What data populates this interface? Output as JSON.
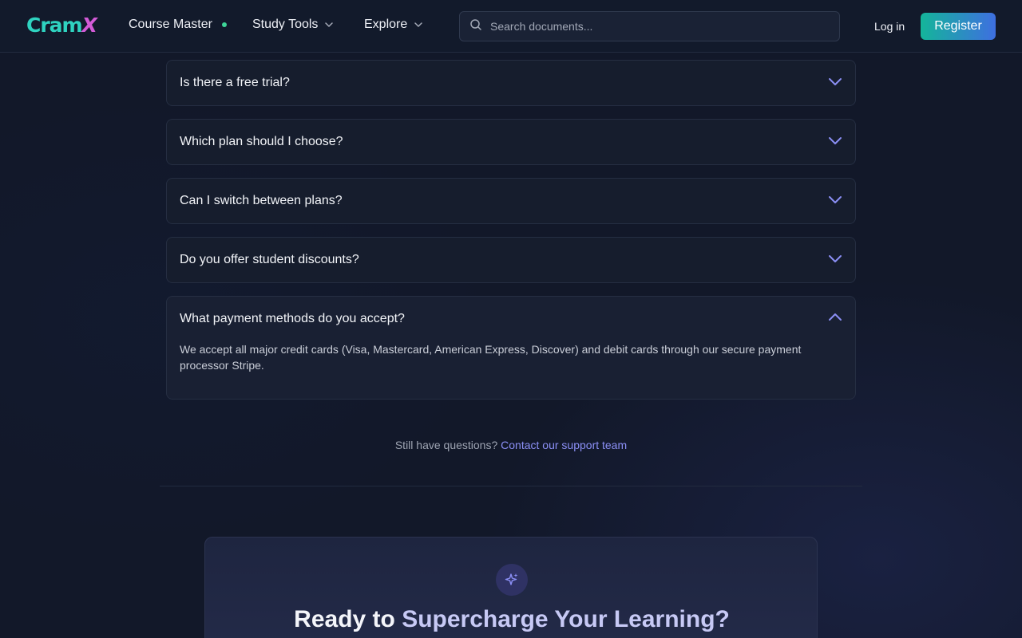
{
  "header": {
    "logo_part1": "Cram",
    "logo_part2": "X",
    "nav": [
      {
        "label": "Course Master",
        "has_dot": true
      },
      {
        "label": "Study Tools",
        "has_chevron": true
      },
      {
        "label": "Explore",
        "has_chevron": true
      }
    ],
    "search_placeholder": "Search documents...",
    "login_label": "Log in",
    "register_label": "Register"
  },
  "faq": {
    "items": [
      {
        "question": "Is there a free trial?",
        "open": false
      },
      {
        "question": "Which plan should I choose?",
        "open": false
      },
      {
        "question": "Can I switch between plans?",
        "open": false
      },
      {
        "question": "Do you offer student discounts?",
        "open": false
      },
      {
        "question": "What payment methods do you accept?",
        "open": true,
        "answer": "We accept all major credit cards (Visa, Mastercard, American Express, Discover) and debit cards through our secure payment processor Stripe."
      }
    ],
    "still_text": "Still have questions?",
    "contact_link": "Contact our support team"
  },
  "cta": {
    "icon": "sparkles-icon",
    "title_part1": "Ready to",
    "title_part2": "Supercharge Your Learning?"
  },
  "colors": {
    "accent": "#8b8ff5",
    "brand_teal": "#2fd3c0",
    "brand_pink": "#d35bd7",
    "status_dot": "#3ed598"
  }
}
